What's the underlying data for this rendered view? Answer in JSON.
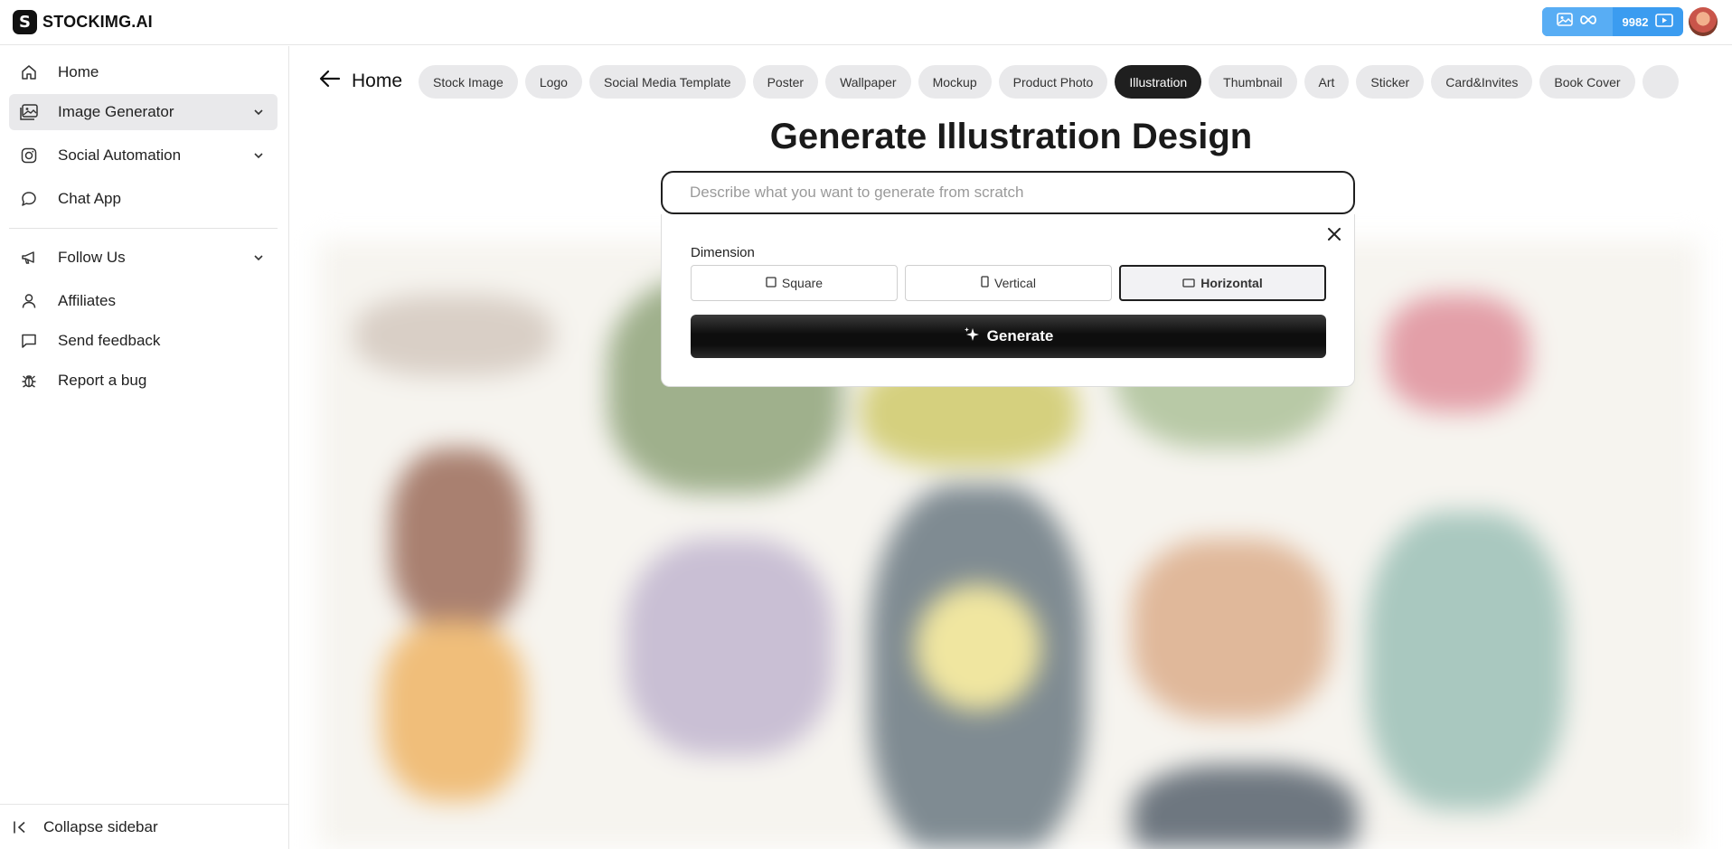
{
  "app": {
    "logo_letter": "S",
    "brand": "STOCKIMG.AI",
    "credits": "9982"
  },
  "sidebar": {
    "items": [
      {
        "label": "Home",
        "icon": "home-icon"
      },
      {
        "label": "Image Generator",
        "icon": "image-icon"
      },
      {
        "label": "Social Automation",
        "icon": "instagram-icon"
      },
      {
        "label": "Chat App",
        "icon": "chat-icon"
      },
      {
        "label": "Follow Us",
        "icon": "megaphone-icon"
      },
      {
        "label": "Affiliates",
        "icon": "user-icon"
      },
      {
        "label": "Send feedback",
        "icon": "message-square-icon"
      },
      {
        "label": "Report a bug",
        "icon": "bug-icon"
      }
    ],
    "collapse_label": "Collapse sidebar"
  },
  "main": {
    "breadcrumb": "Home",
    "tabs": [
      {
        "label": "Stock Image"
      },
      {
        "label": "Logo"
      },
      {
        "label": "Social Media Template"
      },
      {
        "label": "Poster"
      },
      {
        "label": "Wallpaper"
      },
      {
        "label": "Mockup"
      },
      {
        "label": "Product Photo"
      },
      {
        "label": "Illustration",
        "active": true
      },
      {
        "label": "Thumbnail"
      },
      {
        "label": "Art"
      },
      {
        "label": "Sticker"
      },
      {
        "label": "Card&Invites"
      },
      {
        "label": "Book Cover"
      }
    ],
    "heading": "Generate Illustration Design",
    "prompt_placeholder": "Describe what you want to generate from scratch",
    "prompt_value": "",
    "dimension_label": "Dimension",
    "dimensions": [
      {
        "label": "Square"
      },
      {
        "label": "Vertical"
      },
      {
        "label": "Horizontal",
        "selected": true
      }
    ],
    "generate_label": "Generate"
  },
  "colors": {
    "accent_blue": "#3b9cf0",
    "dark": "#1f1f1f",
    "tab_bg": "#e9e9eb"
  }
}
